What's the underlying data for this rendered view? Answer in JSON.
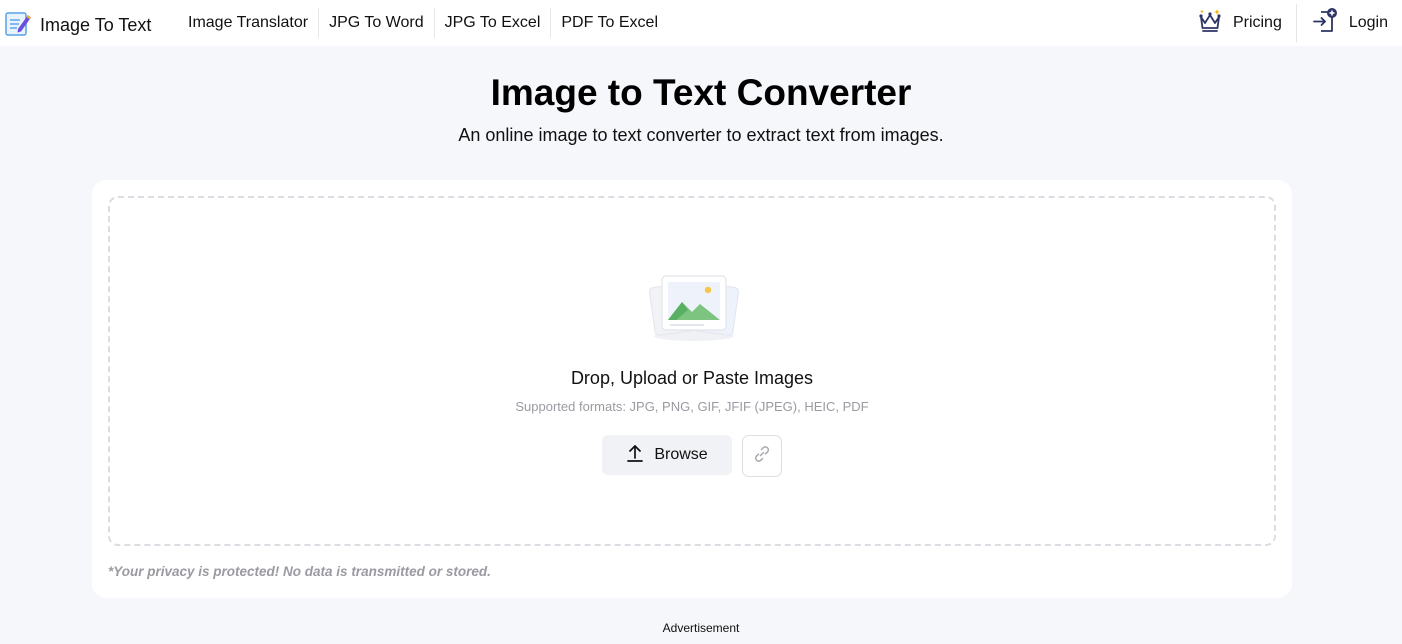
{
  "navbar": {
    "brand": {
      "name": "Image To Text",
      "icon": "notepad-pencil-icon"
    },
    "links": [
      {
        "label": "Image Translator"
      },
      {
        "label": "JPG To Word"
      },
      {
        "label": "JPG To Excel"
      },
      {
        "label": "PDF To Excel"
      }
    ],
    "pricing": {
      "label": "Pricing",
      "icon": "crown-icon"
    },
    "login": {
      "label": "Login",
      "icon": "login-icon"
    }
  },
  "hero": {
    "title": "Image to Text Converter",
    "subtitle": "An online image to text converter to extract text from images."
  },
  "upload": {
    "illustration": "image-files-icon",
    "title": "Drop, Upload or Paste Images",
    "formats": "Supported formats: JPG, PNG, GIF, JFIF (JPEG), HEIC, PDF",
    "browse_label": "Browse",
    "browse_icon": "upload-icon",
    "link_icon": "link-icon",
    "privacy": "*Your privacy is protected! No data is transmitted or stored."
  },
  "footer": {
    "ad_label": "Advertisement"
  },
  "colors": {
    "page_bg": "#f6f7fb",
    "card_bg": "#ffffff",
    "accent_navy": "#2d3566",
    "muted_text": "#9a9aa2"
  }
}
